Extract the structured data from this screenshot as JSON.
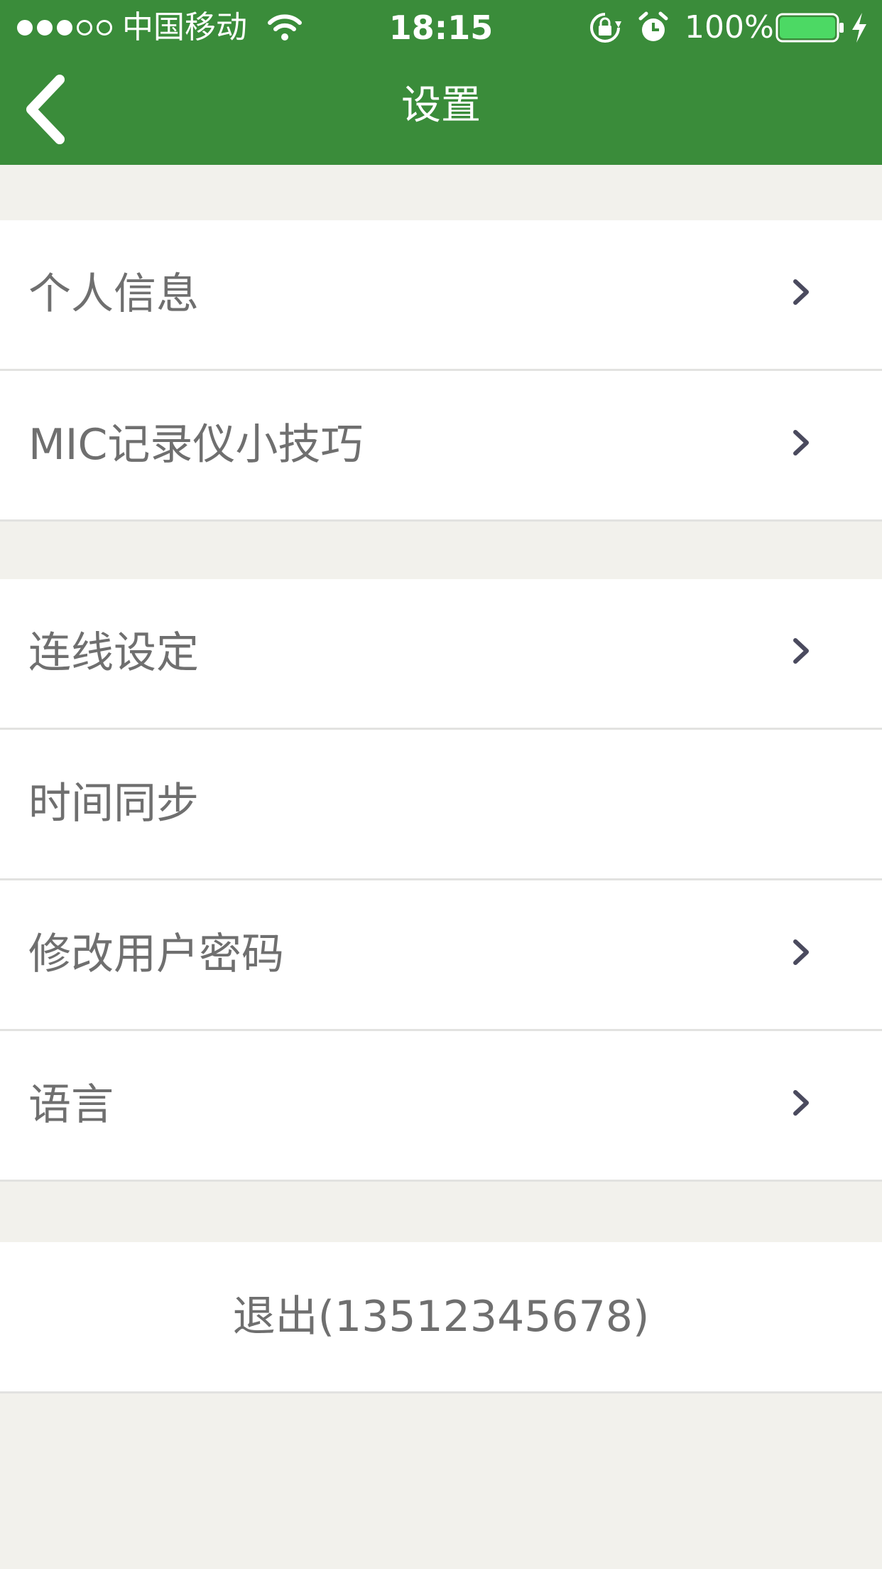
{
  "status_bar": {
    "carrier": "中国移动",
    "time": "18:15",
    "battery_percent": "100%",
    "signal_strength_filled": 3,
    "signal_strength_total": 5,
    "battery_level": 1.0,
    "icons": [
      "wifi-icon",
      "rotation-lock-icon",
      "alarm-icon",
      "battery-icon",
      "charging-icon"
    ]
  },
  "header": {
    "title": "设置",
    "back_icon": "chevron-left-icon"
  },
  "settings": {
    "group1": [
      {
        "label": "个人信息",
        "has_chevron": true
      },
      {
        "label": "MIC记录仪小技巧",
        "has_chevron": true
      }
    ],
    "group2": [
      {
        "label": "连线设定",
        "has_chevron": true
      },
      {
        "label": "时间同步",
        "has_chevron": false
      },
      {
        "label": "修改用户密码",
        "has_chevron": true
      },
      {
        "label": "语言",
        "has_chevron": true
      }
    ],
    "logout_label": "退出(13512345678)"
  },
  "colors": {
    "header_bg": "#3a8c3a",
    "page_bg": "#f2f1ec",
    "row_text": "#6f6f6f",
    "chevron": "#4a4a5e",
    "battery_fill": "#4cd964"
  }
}
